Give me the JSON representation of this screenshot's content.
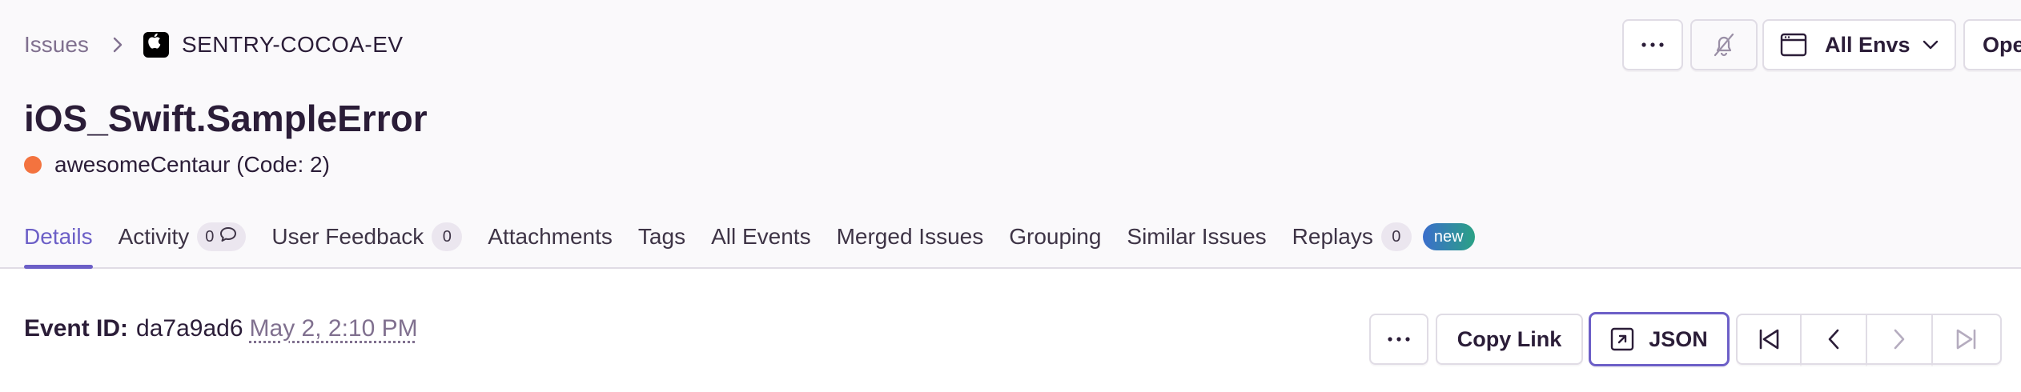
{
  "breadcrumb": {
    "parent": "Issues",
    "project": "SENTRY-COCOA-EV"
  },
  "issue": {
    "title": "iOS_Swift.SampleError",
    "message": "awesomeCentaur (Code: 2)",
    "level_color": "#f3733f"
  },
  "header_actions": {
    "more_icon": "ellipsis-icon",
    "mute_icon": "bell-slash-icon",
    "env_icon": "window-icon",
    "env_label": "All Envs",
    "open_label": "Open"
  },
  "tabs": [
    {
      "label": "Details",
      "active": true
    },
    {
      "label": "Activity",
      "count": "0",
      "icon": "chat-bubble-icon"
    },
    {
      "label": "User Feedback",
      "count": "0"
    },
    {
      "label": "Attachments"
    },
    {
      "label": "Tags"
    },
    {
      "label": "All Events"
    },
    {
      "label": "Merged Issues"
    },
    {
      "label": "Grouping"
    },
    {
      "label": "Similar Issues"
    },
    {
      "label": "Replays",
      "count": "0",
      "badge": "new"
    }
  ],
  "event": {
    "label": "Event ID:",
    "id": "da7a9ad6",
    "time": "May 2, 2:10 PM"
  },
  "event_actions": {
    "more_icon": "ellipsis-icon",
    "copy_link": "Copy Link",
    "json": "JSON"
  },
  "colors": {
    "accent": "#6c5fc7",
    "border": "#e0dce5",
    "text": "#2b1d38",
    "muted": "#80708f"
  }
}
